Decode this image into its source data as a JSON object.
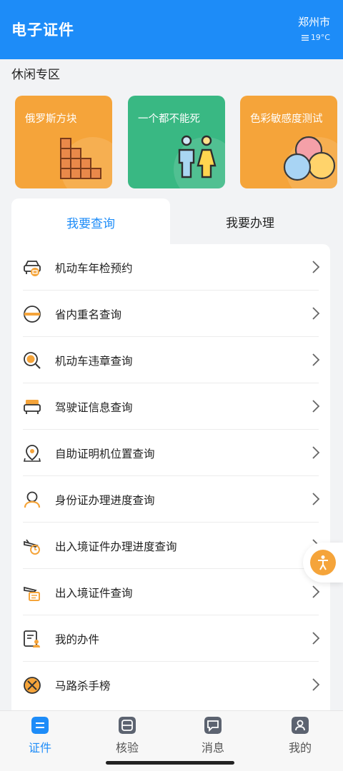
{
  "header": {
    "title": "电子证件",
    "city": "郑州市",
    "weather": "19°C",
    "weather_icon": "haze-icon"
  },
  "leisure": {
    "title": "休闲专区",
    "cards": [
      {
        "label": "俄罗斯方块",
        "icon": "tetris-blocks-icon",
        "color": "#f5a43a"
      },
      {
        "label": "一个都不能死",
        "icon": "couple-icon",
        "color": "#39b883"
      },
      {
        "label": "色彩敏感度测试",
        "icon": "color-circles-icon",
        "color": "#f5a43a"
      }
    ]
  },
  "tabs": [
    {
      "label": "我要查询",
      "active": true
    },
    {
      "label": "我要办理",
      "active": false
    }
  ],
  "list": [
    {
      "label": "机动车年检预约",
      "icon": "car-inspection-icon"
    },
    {
      "label": "省内重名查询",
      "icon": "name-search-icon"
    },
    {
      "label": "机动车违章查询",
      "icon": "violation-search-icon"
    },
    {
      "label": "驾驶证信息查询",
      "icon": "driver-license-icon"
    },
    {
      "label": "自助证明机位置查询",
      "icon": "location-pin-icon"
    },
    {
      "label": "身份证办理进度查询",
      "icon": "id-card-progress-icon"
    },
    {
      "label": "出入境证件办理进度查询",
      "icon": "plane-clock-icon"
    },
    {
      "label": "出入境证件查询",
      "icon": "plane-document-icon"
    },
    {
      "label": "我的办件",
      "icon": "my-documents-icon"
    },
    {
      "label": "马路杀手榜",
      "icon": "road-killer-icon"
    }
  ],
  "bottom_nav": [
    {
      "label": "证件",
      "active": true,
      "icon": "documents-icon"
    },
    {
      "label": "核验",
      "active": false,
      "icon": "verify-icon"
    },
    {
      "label": "消息",
      "active": false,
      "icon": "message-icon"
    },
    {
      "label": "我的",
      "active": false,
      "icon": "profile-icon"
    }
  ],
  "colors": {
    "brand_blue": "#1d8cf8",
    "icon_orange": "#f5a43a",
    "green": "#39b883"
  }
}
